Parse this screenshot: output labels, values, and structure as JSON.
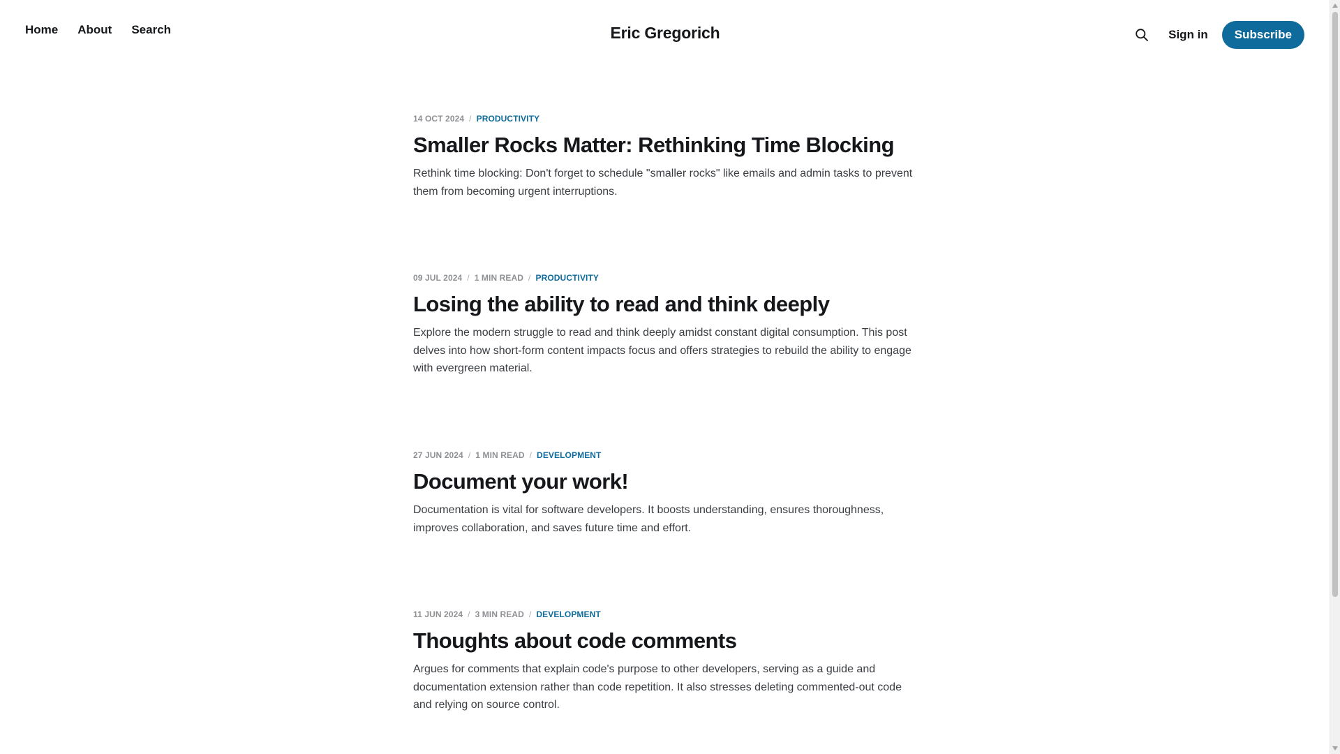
{
  "header": {
    "nav": [
      {
        "label": "Home"
      },
      {
        "label": "About"
      },
      {
        "label": "Search"
      }
    ],
    "site_title": "Eric Gregorich",
    "search_icon": "search-icon",
    "sign_in_label": "Sign in",
    "subscribe_label": "Subscribe"
  },
  "posts": [
    {
      "date": "14 OCT 2024",
      "read_time": "",
      "tag": "PRODUCTIVITY",
      "title": "Smaller Rocks Matter: Rethinking Time Blocking",
      "excerpt": "Rethink time blocking: Don't forget to schedule \"smaller rocks\" like emails and admin tasks to prevent them from becoming urgent interruptions."
    },
    {
      "date": "09 JUL 2024",
      "read_time": "1 MIN READ",
      "tag": "PRODUCTIVITY",
      "title": "Losing the ability to read and think deeply",
      "excerpt": "Explore the modern struggle to read and think deeply amidst constant digital consumption. This post delves into how short-form content impacts focus and offers strategies to rebuild the ability to engage with evergreen material."
    },
    {
      "date": "27 JUN 2024",
      "read_time": "1 MIN READ",
      "tag": "DEVELOPMENT",
      "title": "Document your work!",
      "excerpt": "Documentation is vital for software developers. It boosts understanding, ensures thoroughness, improves collaboration, and saves future time and effort."
    },
    {
      "date": "11 JUN 2024",
      "read_time": "3 MIN READ",
      "tag": "DEVELOPMENT",
      "title": "Thoughts about code comments",
      "excerpt": "Argues for comments that explain code's purpose to other developers, serving as a guide and documentation extension rather than code repetition. It also stresses deleting commented-out code and relying on source control."
    }
  ],
  "colors": {
    "accent": "#0f6b9b",
    "text": "#15171a",
    "meta": "#8e9094"
  }
}
